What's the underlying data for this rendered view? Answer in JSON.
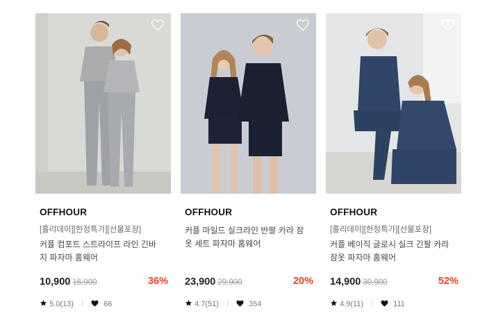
{
  "products": [
    {
      "brand": "OFFHOUR",
      "promo": "[홀리데이][한정특가][선물포장]",
      "name": "커플 컴포트 스트라이프 라인 긴바지 파자마 홈웨어",
      "price": "10,900",
      "original_price": "16,900",
      "discount": "36%",
      "rating": "5.0(13)",
      "likes": "66",
      "bg": "#d9d9d6",
      "outfit": "#a9abad"
    },
    {
      "brand": "OFFHOUR",
      "promo": "",
      "name": "커플 마일드 실크라인 반팔 카라 잠옷 세트 파자마 홈웨어",
      "price": "23,900",
      "original_price": "29,900",
      "discount": "20%",
      "rating": "4.7(51)",
      "likes": "354",
      "bg": "#c9cdd3",
      "outfit": "#1b2233"
    },
    {
      "brand": "OFFHOUR",
      "promo": "[홀리데이][한정특가][선물포장]",
      "name": "커플 베이직 글로시 실크 긴팔 카라 잠옷 파자마 홈웨어",
      "price": "14,900",
      "original_price": "30,900",
      "discount": "52%",
      "rating": "4.9(11)",
      "likes": "111",
      "bg": "#e4e5e6",
      "outfit": "#2f4668"
    }
  ],
  "colors": {
    "discount": "#e8421c",
    "text": "#222222",
    "muted": "#999999"
  },
  "icons": {
    "wishlist": "heart-outline-icon",
    "rating": "star-icon",
    "likes": "heart-filled-icon"
  }
}
